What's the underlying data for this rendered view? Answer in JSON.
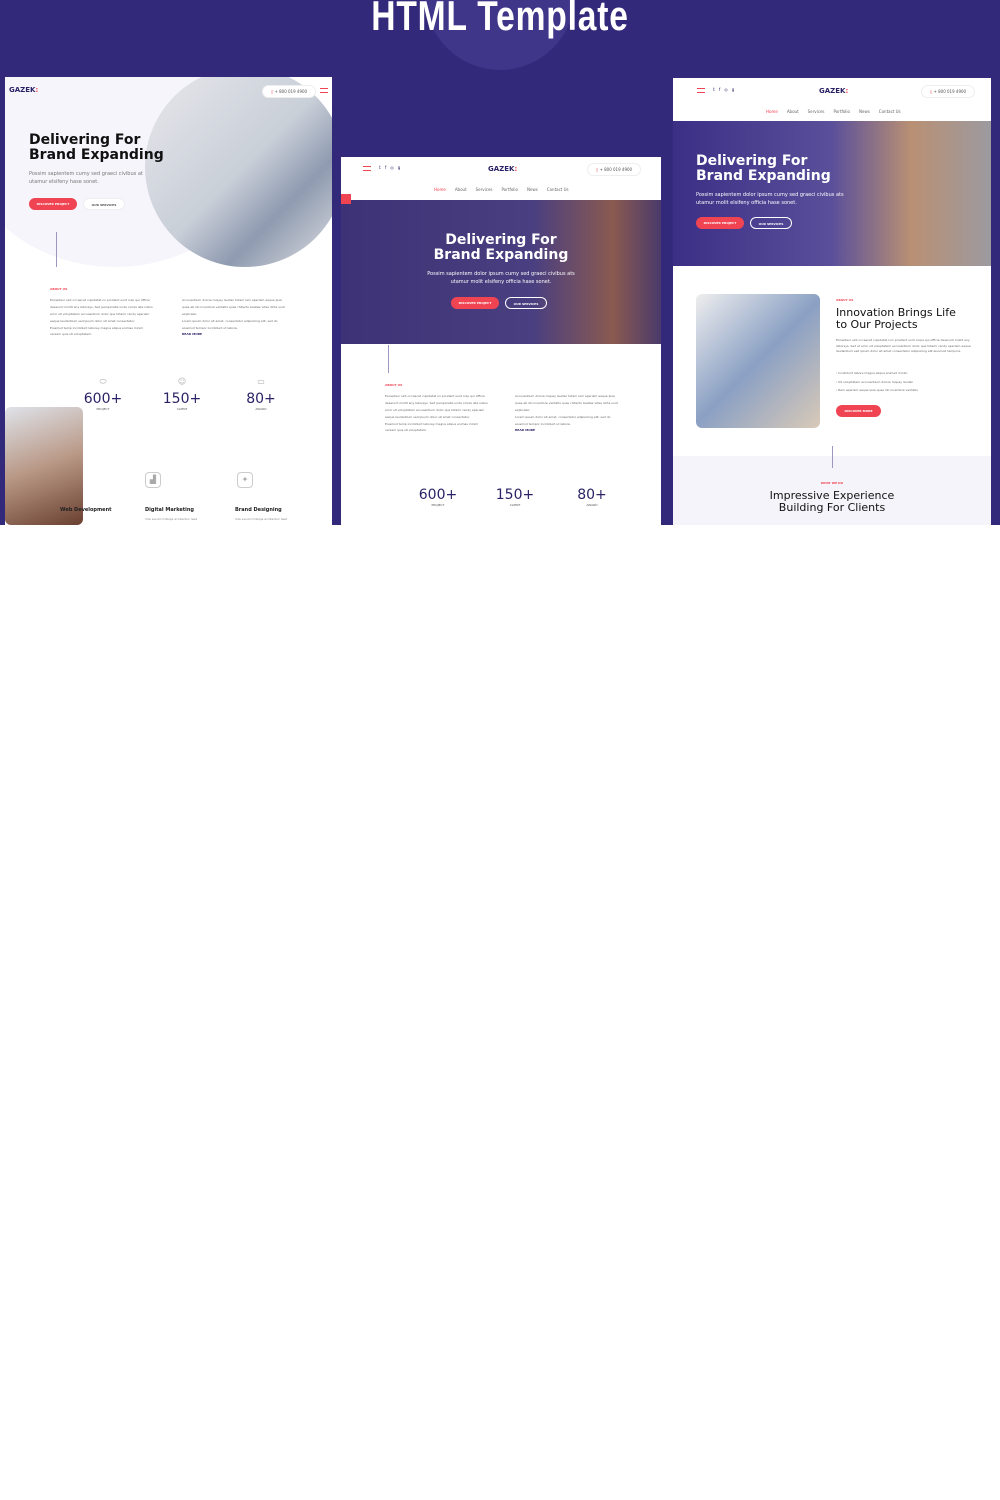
{
  "banner": {
    "title": "HTML Template",
    "background": "#33297b"
  },
  "brand": {
    "logo": "GAZEK",
    "logo_mark": ":",
    "accent": "#f04452",
    "primary": "#2a2266"
  },
  "phone": "+ 800 019 4900",
  "nav": [
    "Home",
    "About",
    "Services",
    "Portfolio",
    "News",
    "Contact Us"
  ],
  "social": [
    "twitter-icon",
    "facebook-icon",
    "instagram-icon",
    "google-plus-icon"
  ],
  "hero": {
    "title_line1": "Delivering For",
    "title_line2": "Brand Expanding",
    "text_short": "Possim sapientem cumy sed graeci civibus at utamur elsifeny hase sonet.",
    "text_long": "Possim sapientem dolor ipsum cumy sed graeci civibus ats utamur molit elsifeny officia hase sonet.",
    "primary_button": "DISCOVER PROJECT",
    "secondary_button": "OUR SERVICES"
  },
  "about": {
    "label": "ABOUT US",
    "col1": "Excepteur sint occaecat cupidatat no proident sunt culp qui officia deserunt mollit any laborsys. Sed perspiciatis unde omnis iste natus error sit voluptatem accusantium dolor que totamr rendy aperiam eaque laudantium sed ipsum dolor sit amet consectetur.",
    "col1b": "Eiusmod temp incididunt laborey magna aliqua enimas minim veniam quis sit voluptatem.",
    "col2": "Accusantium dolore mquey laudan totam rem aperiam eaque ipsa quae ab illo inventore veritatis quas chitecto beatae vitae dicta sunt explicabo.",
    "col2b": "Lorem ipsum dolor sit amet, consectetur adipisicing elit, sed do eiusmod tempor incididunt ut labore.",
    "read_more": "READ MORE"
  },
  "stats": [
    {
      "value": "600+",
      "label": "PROJECT",
      "icon": "pills-icon"
    },
    {
      "value": "150+",
      "label": "CLIENT",
      "icon": "user-icon"
    },
    {
      "value": "80+",
      "label": "AWARD",
      "icon": "monitor-icon"
    }
  ],
  "services": [
    {
      "title": "Web Development",
      "text": "Vde ssoum tritanja acribentur iwet"
    },
    {
      "title": "Digital Marketing",
      "text": "Vde ssoum tritanja acribentur iwet"
    },
    {
      "title": "Brand Designing",
      "text": "Vde ssoum tritanja acribentur iwet"
    }
  ],
  "innovation": {
    "label": "ABOUT US",
    "title_line1": "Innovation Brings Life",
    "title_line2": "to Our Projects",
    "text": "Excepteur sint occaecat cupidatat non proident sunt culpa qui officia deserunt mollit any laborsys. Sed ut error sit voluptatem accusantium dolor que totamr rendy aperiam eaque laudantium sed ipsum dolor sit amet consectetur adipisicing elit eiusmod tempora.",
    "bullets": [
      "Incididunt labore magna aliqua enimad minim",
      "Sit voluptatem accusantium dolore mquey laudan",
      "Rem aperiam eaque ipsa quae illo inventore veritatis"
    ],
    "button": "DISCOVER MORE"
  },
  "clients": {
    "label": "WHAT WE DO",
    "title_line1": "Impressive Experience",
    "title_line2": "Building For Clients"
  }
}
